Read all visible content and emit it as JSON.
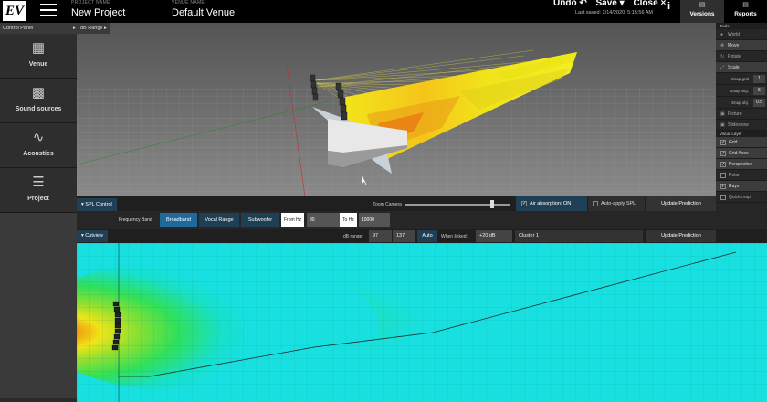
{
  "header": {
    "project_caption": "PROJECT NAME",
    "project_name": "New Project",
    "venue_caption": "VENUE NAME",
    "venue_name": "Default Venue",
    "undo": "Undo ↶",
    "save": "Save ▾",
    "close": "Close ×",
    "last_saved": "Last saved: 2/14/2020, 5:15:56 AM",
    "logo": "EV",
    "info": "i",
    "versions": "Versions",
    "reports": "Reports"
  },
  "left_panel": {
    "control_panel": "Control Panel",
    "nav": [
      {
        "label": "Venue",
        "icon": "venue-icon"
      },
      {
        "label": "Sound sources",
        "icon": "speaker-array-icon"
      },
      {
        "label": "Acoustics",
        "icon": "waveform-icon"
      },
      {
        "label": "Project",
        "icon": "list-icon"
      }
    ]
  },
  "viewport": {
    "db_range": "dB Range"
  },
  "tools": {
    "section_tools": "Tools",
    "items": [
      {
        "label": "World",
        "active": false
      },
      {
        "label": "Move",
        "active": true
      },
      {
        "label": "Rotate",
        "active": false
      },
      {
        "label": "Scale",
        "active": true
      }
    ],
    "snap": [
      {
        "label": "Snap grid",
        "value": "1"
      },
      {
        "label": "Snap ang.",
        "value": "5"
      },
      {
        "label": "Snap obj.",
        "value": "0.5"
      }
    ],
    "picture": "Picture",
    "slideshow": "Slideshow",
    "section_visual": "Visual Layer",
    "layers": [
      {
        "label": "Grid",
        "checked": true
      },
      {
        "label": "Grid Axes",
        "checked": true
      },
      {
        "label": "Perspective",
        "checked": true
      },
      {
        "label": "Polar",
        "checked": false
      },
      {
        "label": "Rays",
        "checked": true
      },
      {
        "label": "Quick map",
        "checked": false
      }
    ]
  },
  "spl": {
    "title": "SPL Control",
    "zoom_camera": "Zoom Camera",
    "zoom_level": 0.83,
    "air_absorption": "Air absorption: ON",
    "auto_apply": "Auto-apply SPL",
    "update": "Update Prediction",
    "frequency_band": "Frequency Band",
    "bands": [
      "Broadband",
      "Vocal Range",
      "Subwoofer"
    ],
    "selected_band": "Broadband",
    "from_hz_label": "From Hz",
    "from_hz": "30",
    "to_hz_label": "To Hz",
    "to_hz": "10000"
  },
  "cutview": {
    "title": "Cutview",
    "db_range_label": "dB range:",
    "db_min": "97",
    "db_max": "137",
    "auto": "Auto",
    "when_linked_label": "When linked:",
    "when_linked": "+20 dB",
    "cluster": "Cluster 1",
    "update": "Update Prediction"
  },
  "colors": {
    "accent": "#1f3f55",
    "map_cyan": "#18e0e0",
    "map_green": "#3fe04a",
    "map_yellow": "#f0e010",
    "map_red": "#e84010"
  }
}
